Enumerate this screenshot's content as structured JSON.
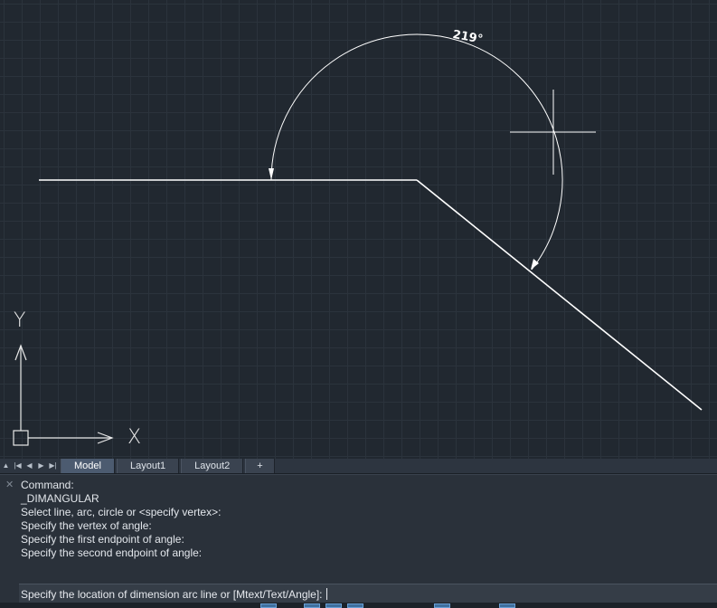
{
  "drawing": {
    "dimension_text": "219°"
  },
  "ucs": {
    "x_label": "X",
    "y_label": "Y"
  },
  "tabs": {
    "nav": [
      "first-icon",
      "prev-icon",
      "next-icon",
      "last-icon"
    ],
    "items": [
      {
        "label": "Model",
        "active": true
      },
      {
        "label": "Layout1",
        "active": false
      },
      {
        "label": "Layout2",
        "active": false
      },
      {
        "label": "+",
        "active": false
      }
    ]
  },
  "command": {
    "history": [
      "Command:",
      "_DIMANGULAR",
      "Select line, arc, circle or <specify vertex>:",
      "Specify the vertex of angle:",
      "Specify the first endpoint of angle:",
      "Specify the second endpoint of angle:"
    ],
    "prompt": "Specify the location of dimension arc line or [Mtext/Text/Angle]:"
  },
  "colors": {
    "background": "#212830",
    "geometry": "#ffffff",
    "active_tab": "#4c5b70"
  }
}
